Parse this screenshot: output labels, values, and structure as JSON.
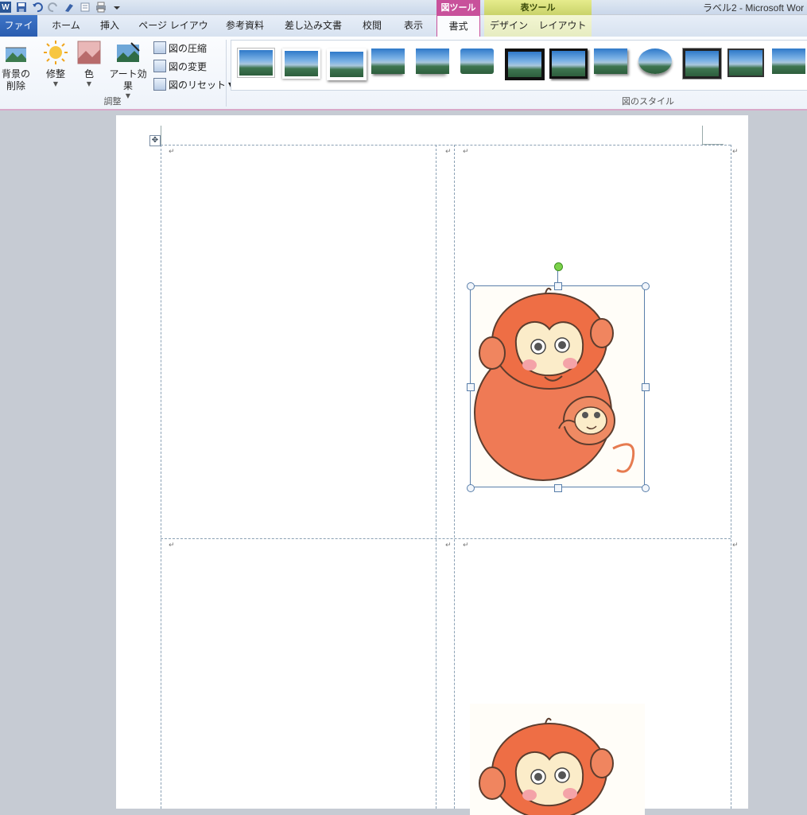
{
  "window": {
    "title": "ラベル2 - Microsoft Wor",
    "app_logo": "W"
  },
  "qat": {
    "icons": [
      "word-logo-icon",
      "save-icon",
      "undo-icon",
      "redo-icon",
      "format-painter-icon",
      "print-preview-icon",
      "print-icon",
      "customize-qat-icon"
    ]
  },
  "context_tabs": {
    "picture_tools": "図ツール",
    "table_tools": "表ツール"
  },
  "tabs": {
    "file": "ファイル",
    "home": "ホーム",
    "insert": "挿入",
    "page_layout": "ページ レイアウト",
    "references": "参考資料",
    "mailings": "差し込み文書",
    "review": "校閲",
    "view": "表示",
    "format": "書式",
    "design": "デザイン",
    "layout": "レイアウト"
  },
  "ribbon": {
    "adjust_group": {
      "label": "調整",
      "remove_background": "背景の\n削除",
      "corrections": "修整",
      "color": "色",
      "artistic_effects": "アート効果",
      "compress": "図の圧縮",
      "change_picture": "図の変更",
      "reset_picture": "図のリセット"
    },
    "styles_group": {
      "label": "図のスタイル",
      "style_count": 13
    }
  },
  "document": {
    "paragraph_mark": "↵",
    "table_move_glyph": "✥",
    "picture_subject": "monkey-illustration"
  },
  "colors": {
    "picture_tools_accent": "#c8519b",
    "table_tools_accent": "#d2db6f",
    "file_tab": "#2a5db0",
    "workspace": "#c6cbd3"
  }
}
